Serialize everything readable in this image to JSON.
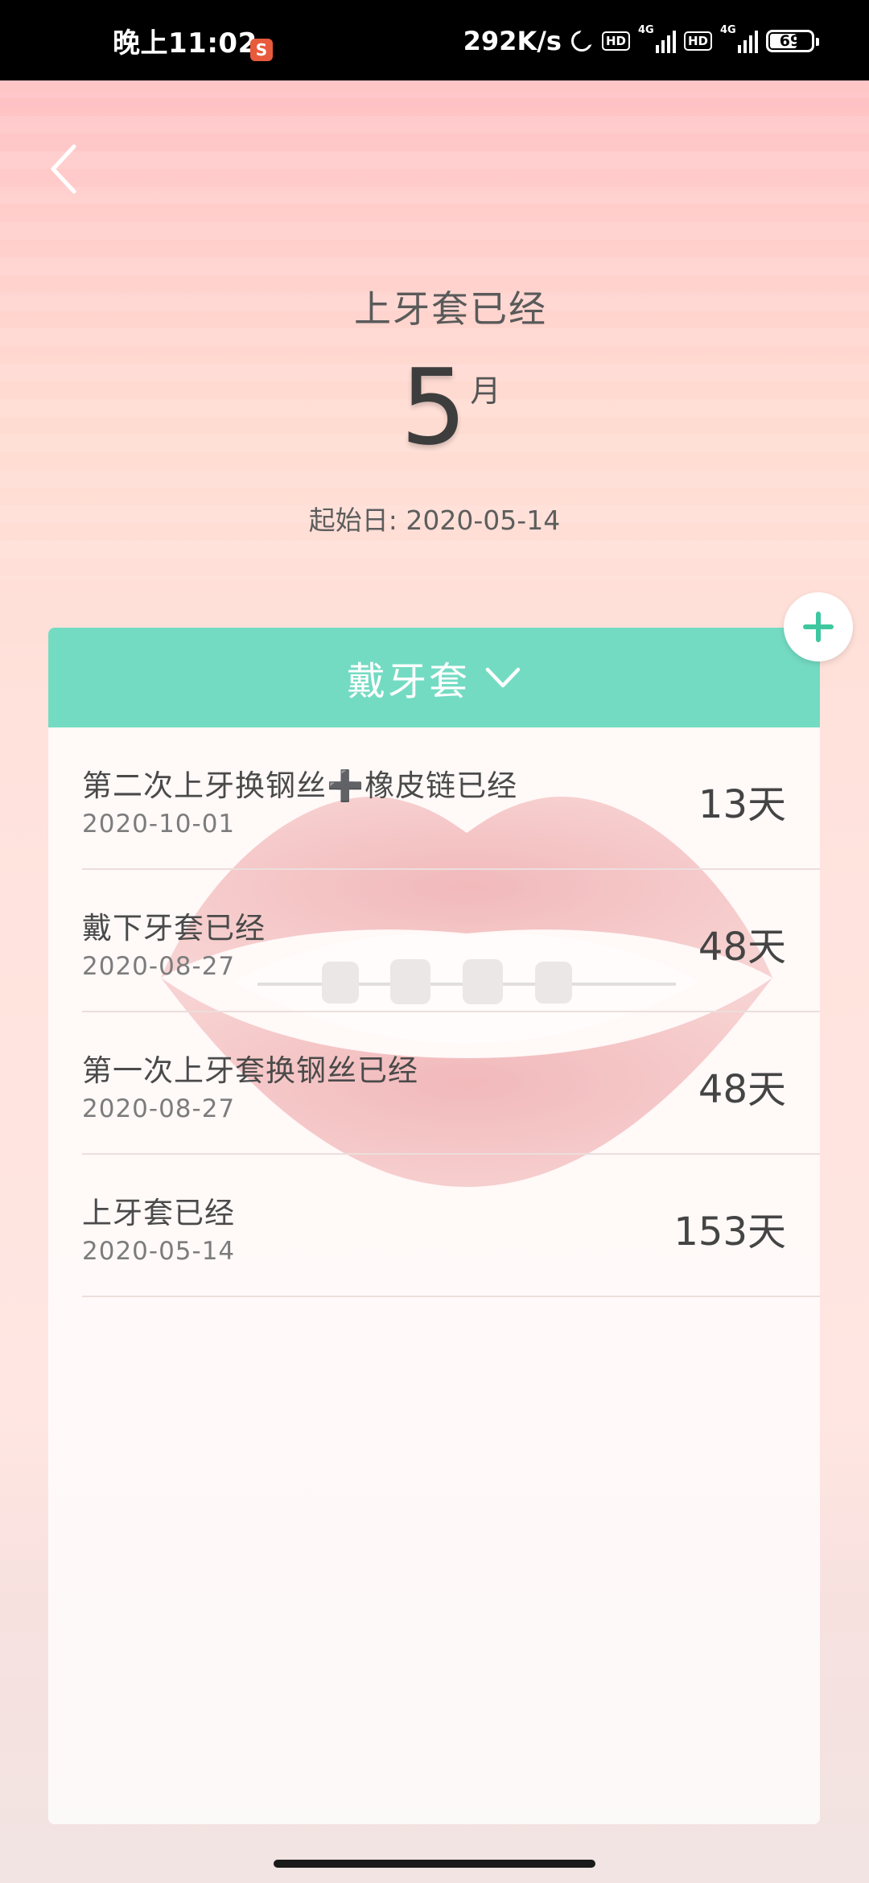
{
  "status_bar": {
    "time": "晚上11:02",
    "network_speed": "292K/s",
    "hd_label_1": "HD",
    "signal_label_1": "4G",
    "hd_label_2": "HD",
    "signal_label_2": "4G",
    "battery": "69",
    "battery_level": 0.69,
    "icons": [
      "sogou-input-icon",
      "moon-icon",
      "hd-icon",
      "signal-4g-icon",
      "hd-icon",
      "signal-4g-icon",
      "battery-icon"
    ]
  },
  "header": {
    "back_icon": "chevron-left-icon",
    "title": "上牙套已经",
    "value": "5",
    "unit": "月",
    "start_date_label": "起始日:",
    "start_date": "2020-05-14"
  },
  "card": {
    "header_label": "戴牙套",
    "header_icon": "chevron-down-icon",
    "accent_color": "#74dbc3",
    "add_icon": "plus-icon",
    "items": [
      {
        "title": "第二次上牙换钢丝➕橡皮链已经",
        "date": "2020-10-01",
        "days": "13天"
      },
      {
        "title": "戴下牙套已经",
        "date": "2020-08-27",
        "days": "48天"
      },
      {
        "title": "第一次上牙套换钢丝已经",
        "date": "2020-08-27",
        "days": "48天"
      },
      {
        "title": "上牙套已经",
        "date": "2020-05-14",
        "days": "153天"
      }
    ]
  }
}
